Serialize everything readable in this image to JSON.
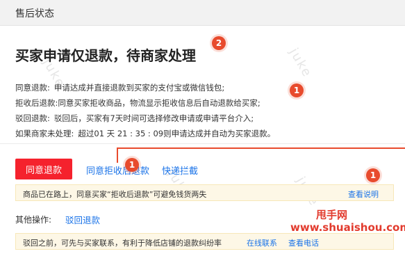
{
  "header": {
    "title": "售后状态"
  },
  "main": {
    "title": "买家申请仅退款，待商家处理"
  },
  "watermark": {
    "text": "juke"
  },
  "badges": {
    "b1": "2",
    "b2": "1",
    "b3": "1",
    "b4": "1"
  },
  "info": [
    {
      "label": "同意退款:",
      "text": "申请达成并直接退款到买家的支付宝或微信钱包;"
    },
    {
      "label": "拒收后退款:",
      "text": "同意买家拒收商品，物流显示拒收信息后自动退款给买家;"
    },
    {
      "label": "驳回退款:",
      "text": "驳回后，买家有7天时间可选择修改申请或申请平台介入;"
    },
    {
      "label": "如果商家未处理:",
      "text": "超过01 天 21 : 35 : 09则申请达成并自动为买家退款。"
    }
  ],
  "actions": {
    "agree_label": "同意退款",
    "agree_after_reject_label": "同意拒收后退款",
    "express_intercept_label": "快递拦截"
  },
  "notice1": {
    "text": "商品已在路上，同意买家“拒收后退款”可避免钱货两失",
    "link": "查看说明"
  },
  "other": {
    "label": "其他操作:",
    "reject_label": "驳回退款"
  },
  "notice2": {
    "text": "驳回之前，可先与买家联系，有利于降低店铺的退款纠纷率",
    "contact_link": "在线联系",
    "phone_link": "查看电话"
  },
  "branding": {
    "name": "甩手网",
    "site": "www.shuaishou.com"
  },
  "colors": {
    "accent_red": "#f5222d",
    "link_blue": "#1a73e8",
    "badge": "#e84b2d",
    "notice_bg": "#fdf7e6"
  }
}
